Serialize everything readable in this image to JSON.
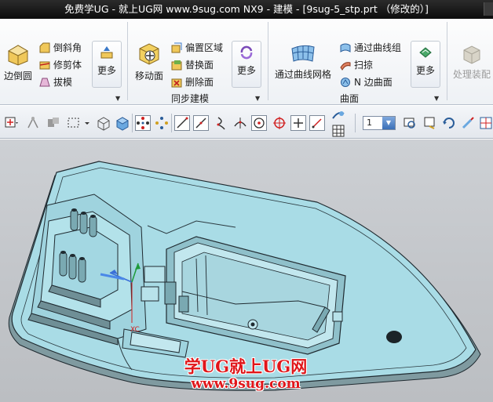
{
  "window": {
    "title": "免费学UG - 就上UG网 www.9sug.com NX9 - 建模 - [9sug-5_stp.prt （修改的）]"
  },
  "ribbon": {
    "feature": {
      "edge_blend": "边倒圆",
      "chamfer": "倒斜角",
      "trim_body": "修剪体",
      "draft": "拔模",
      "more": "更多"
    },
    "sync": {
      "move_face": "移动面",
      "offset_region": "偏置区域",
      "replace_face": "替换面",
      "delete_face": "删除面",
      "more": "更多",
      "group_label": "同步建模"
    },
    "surface": {
      "through_curve_mesh": "通过曲线网格",
      "through_curves": "通过曲线组",
      "swept": "扫掠",
      "n_sided": "N 边曲面",
      "more": "更多",
      "group_label": "曲面"
    },
    "assembly": {
      "process_assembly": "处理装配"
    }
  },
  "toolbar": {
    "layer_combo_value": "1",
    "icons": [
      "select-filter-icon",
      "snap-icon",
      "part-nav-icon",
      "rect-select-icon",
      "cube-outline-icon",
      "cube-solid-icon",
      "snap-points-icon",
      "snap-grid-icon",
      "line-icon",
      "diag-line-icon",
      "curve-icon",
      "tangent-icon",
      "circle-center-icon",
      "circle-target-icon",
      "plus-point-icon",
      "pen-line-icon",
      "measure-icon",
      "grid-icon"
    ]
  },
  "viewport": {
    "watermark_line1": "学UG就上UG网",
    "watermark_line2": "www.9sug.com",
    "axis_label_x": "XC"
  },
  "colors": {
    "model_face": "#a9dce6",
    "model_edge": "#1f2a30",
    "watermark": "#e0161a"
  }
}
